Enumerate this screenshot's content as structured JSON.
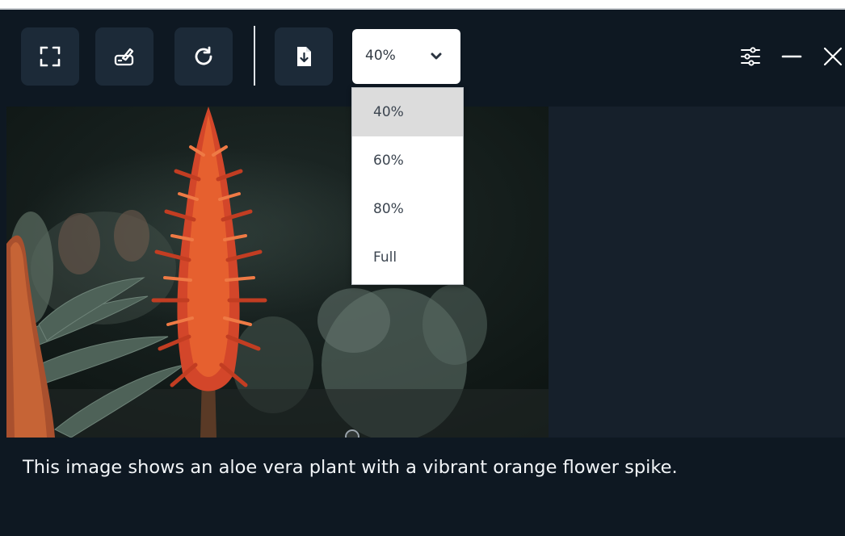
{
  "toolbar": {
    "buttons": [
      {
        "name": "fullscreen-button",
        "icon": "fullscreen-icon"
      },
      {
        "name": "annotate-button",
        "icon": "draw-icon"
      },
      {
        "name": "refresh-button",
        "icon": "refresh-icon"
      },
      {
        "name": "save-button",
        "icon": "file-download-icon"
      }
    ],
    "zoom": {
      "value": "40%",
      "options": [
        "40%",
        "60%",
        "80%",
        "Full"
      ],
      "selected_index": 0
    },
    "window_controls": [
      {
        "name": "settings-button",
        "icon": "sliders-icon"
      },
      {
        "name": "minimize-button",
        "icon": "minimize-icon"
      },
      {
        "name": "close-button",
        "icon": "close-icon"
      }
    ]
  },
  "caption": "This image shows an aloe vera plant with a vibrant orange flower spike.",
  "colors": {
    "background": "#0e1822",
    "button_bg": "#1c2a38",
    "photo_panel": "#16202b",
    "caption_text": "#f2f5f8",
    "menu_selected": "#dcdcdc"
  }
}
